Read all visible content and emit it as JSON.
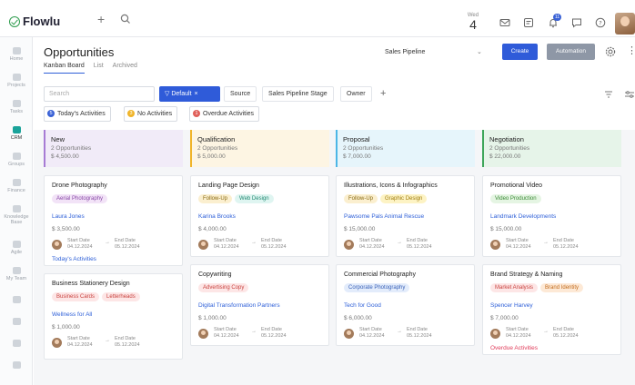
{
  "topbar": {
    "logo": "Flowlu",
    "date_dow": "Wed",
    "date_day": "4",
    "notif_count": "11"
  },
  "sidebar": {
    "items": [
      "Home",
      "Projects",
      "Tasks",
      "CRM",
      "Groups",
      "Finance",
      "Knowledge Base",
      "Agile",
      "My Team"
    ]
  },
  "header": {
    "title": "Opportunities",
    "tabs": [
      "Kanban Board",
      "List",
      "Archived"
    ],
    "pipeline": "Sales Pipeline",
    "create": "Create",
    "automation": "Automation"
  },
  "filters": {
    "search_placeholder": "Search",
    "default": "Default",
    "chips": [
      "Source",
      "Sales Pipeline Stage",
      "Owner"
    ]
  },
  "activities": [
    {
      "count": "5",
      "label": "Today's Activities",
      "color": "#3a62d6"
    },
    {
      "count": "3",
      "label": "No Activities",
      "color": "#f0b429"
    },
    {
      "count": "1",
      "label": "Overdue Activities",
      "color": "#e0605a"
    }
  ],
  "columns": [
    {
      "title": "New",
      "count": "2 Opportunities",
      "amount": "$ 4,500.00",
      "color": "#a77bd4",
      "bg": "#f1ebf8"
    },
    {
      "title": "Qualification",
      "count": "2 Opportunities",
      "amount": "$ 5,000.00",
      "color": "#f0b429",
      "bg": "#fdf5e3"
    },
    {
      "title": "Proposal",
      "count": "2 Opportunities",
      "amount": "$ 7,000.00",
      "color": "#4db6e6",
      "bg": "#e6f5fb"
    },
    {
      "title": "Negotiation",
      "count": "2 Opportunities",
      "amount": "$ 22,000.00",
      "color": "#3ea65a",
      "bg": "#e6f4e9"
    }
  ],
  "date_labels": {
    "start": "Start Date",
    "end": "End Date"
  },
  "cards": [
    {
      "title": "Drone Photography",
      "tags": [
        {
          "t": "Aerial Photography",
          "bg": "#f2e3f7",
          "fg": "#8a4aa8"
        }
      ],
      "company": "Laura Jones",
      "amount": "$ 3,500.00",
      "start": "04.12.2024",
      "end": "05.12.2024",
      "link": "Today's Activities",
      "link_color": "blue"
    },
    {
      "title": "Business Stationery Design",
      "tags": [
        {
          "t": "Business Cards",
          "bg": "#fde6e6",
          "fg": "#c9423e"
        },
        {
          "t": "Letterheads",
          "bg": "#fde6e6",
          "fg": "#c9423e"
        }
      ],
      "company": "Wellness for All",
      "amount": "$ 1,000.00",
      "start": "04.12.2024",
      "end": "05.12.2024"
    },
    {
      "title": "Landing Page Design",
      "tags": [
        {
          "t": "Follow-Up",
          "bg": "#fbefcf",
          "fg": "#8a6b12"
        },
        {
          "t": "Web Design",
          "bg": "#dff5f1",
          "fg": "#238a73"
        }
      ],
      "company": "Karina Brooks",
      "amount": "$ 4,000.00",
      "start": "04.12.2024",
      "end": "05.12.2024"
    },
    {
      "title": "Copywriting",
      "tags": [
        {
          "t": "Advertising Copy",
          "bg": "#fde6e6",
          "fg": "#c9423e"
        }
      ],
      "company": "Digital Transformation Partners",
      "amount": "$ 1,000.00",
      "start": "04.12.2024",
      "end": "05.12.2024"
    },
    {
      "title": "Illustrations, Icons & Infographics",
      "tags": [
        {
          "t": "Follow-Up",
          "bg": "#fbefcf",
          "fg": "#8a6b12"
        },
        {
          "t": "Graphic Design",
          "bg": "#fdf3c4",
          "fg": "#a07d0e"
        }
      ],
      "company": "Pawsome Pals Animal Rescue",
      "amount": "$ 15,000.00",
      "start": "04.12.2024",
      "end": "05.12.2024"
    },
    {
      "title": "Commercial Photography",
      "tags": [
        {
          "t": "Corporate Photography",
          "bg": "#e3ecfb",
          "fg": "#3a62b8"
        }
      ],
      "company": "Tech for Good",
      "amount": "$ 6,000.00",
      "start": "04.12.2024",
      "end": "05.12.2024"
    },
    {
      "title": "Promotional Video",
      "tags": [
        {
          "t": "Video Production",
          "bg": "#e5f5e3",
          "fg": "#3a8a35"
        }
      ],
      "company": "Landmark Developments",
      "amount": "$ 15,000.00",
      "start": "04.12.2024",
      "end": "05.12.2024"
    },
    {
      "title": "Brand Strategy & Naming",
      "tags": [
        {
          "t": "Market Analysis",
          "bg": "#fde6e6",
          "fg": "#c9423e"
        },
        {
          "t": "Brand Identity",
          "bg": "#fde9d6",
          "fg": "#c26b1c"
        }
      ],
      "company": "Spencer Harvey",
      "amount": "$ 7,000.00",
      "start": "04.12.2024",
      "end": "05.12.2024",
      "link": "Overdue Activities",
      "link_color": "red"
    }
  ]
}
